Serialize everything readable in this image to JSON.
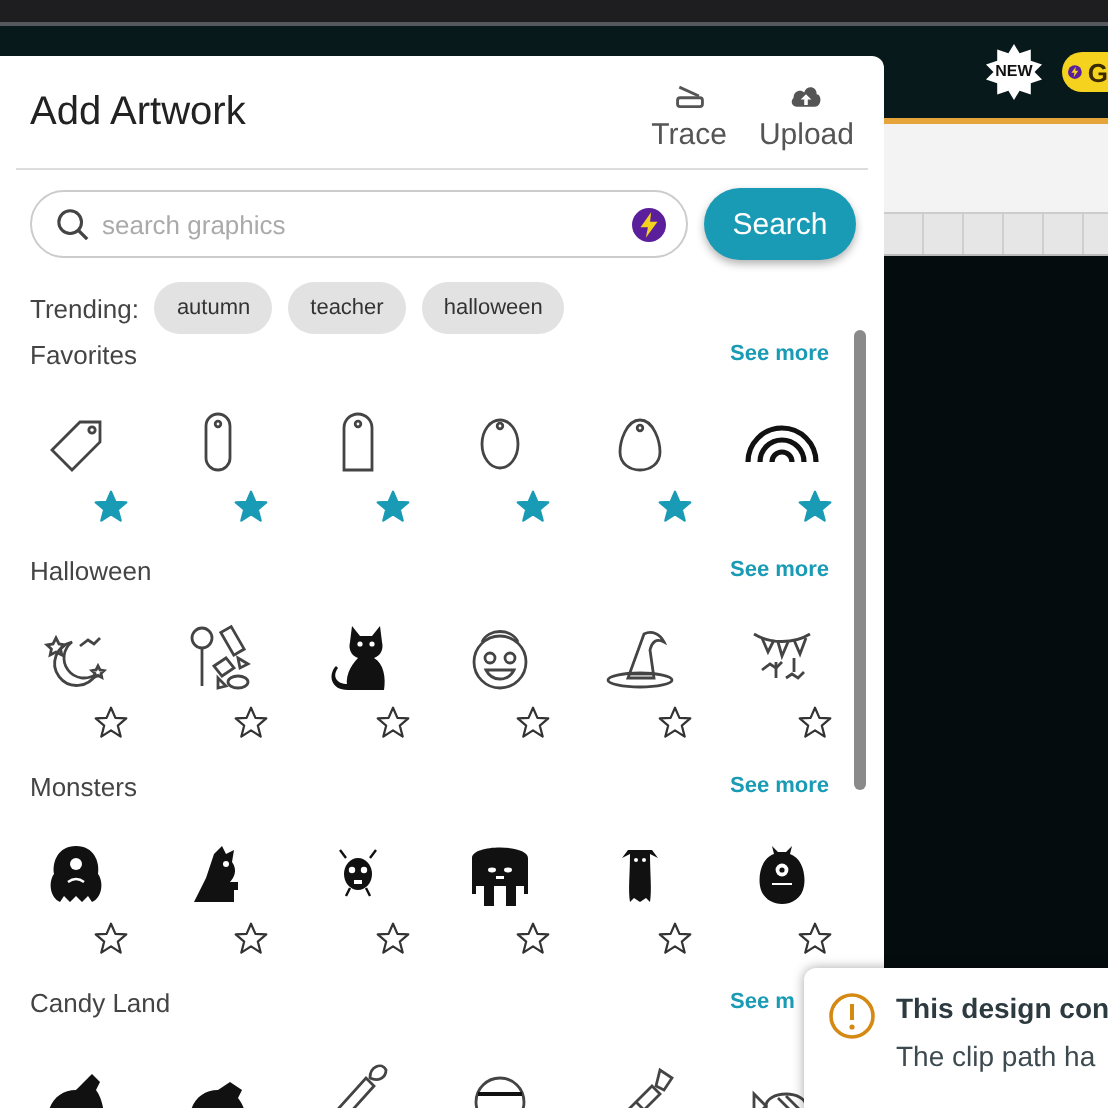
{
  "header": {
    "badge": "NEW",
    "pill_text": "G"
  },
  "panel": {
    "title": "Add Artwork",
    "actions": [
      {
        "label": "Trace"
      },
      {
        "label": "Upload"
      }
    ],
    "search": {
      "placeholder": "search graphics",
      "button": "Search"
    },
    "trending": {
      "label": "Trending:",
      "tags": [
        "autumn",
        "teacher",
        "halloween"
      ]
    },
    "sections": [
      {
        "title": "Favorites",
        "see_more": "See more",
        "favorites": [
          true,
          true,
          true,
          true,
          true,
          true
        ]
      },
      {
        "title": "Halloween",
        "see_more": "See more",
        "favorites": [
          false,
          false,
          false,
          false,
          false,
          false
        ]
      },
      {
        "title": "Monsters",
        "see_more": "See more",
        "favorites": [
          false,
          false,
          false,
          false,
          false,
          false
        ]
      },
      {
        "title": "Candy Land",
        "see_more": "See m"
      }
    ]
  },
  "toast": {
    "title": "This design con",
    "message": "The clip path ha"
  }
}
